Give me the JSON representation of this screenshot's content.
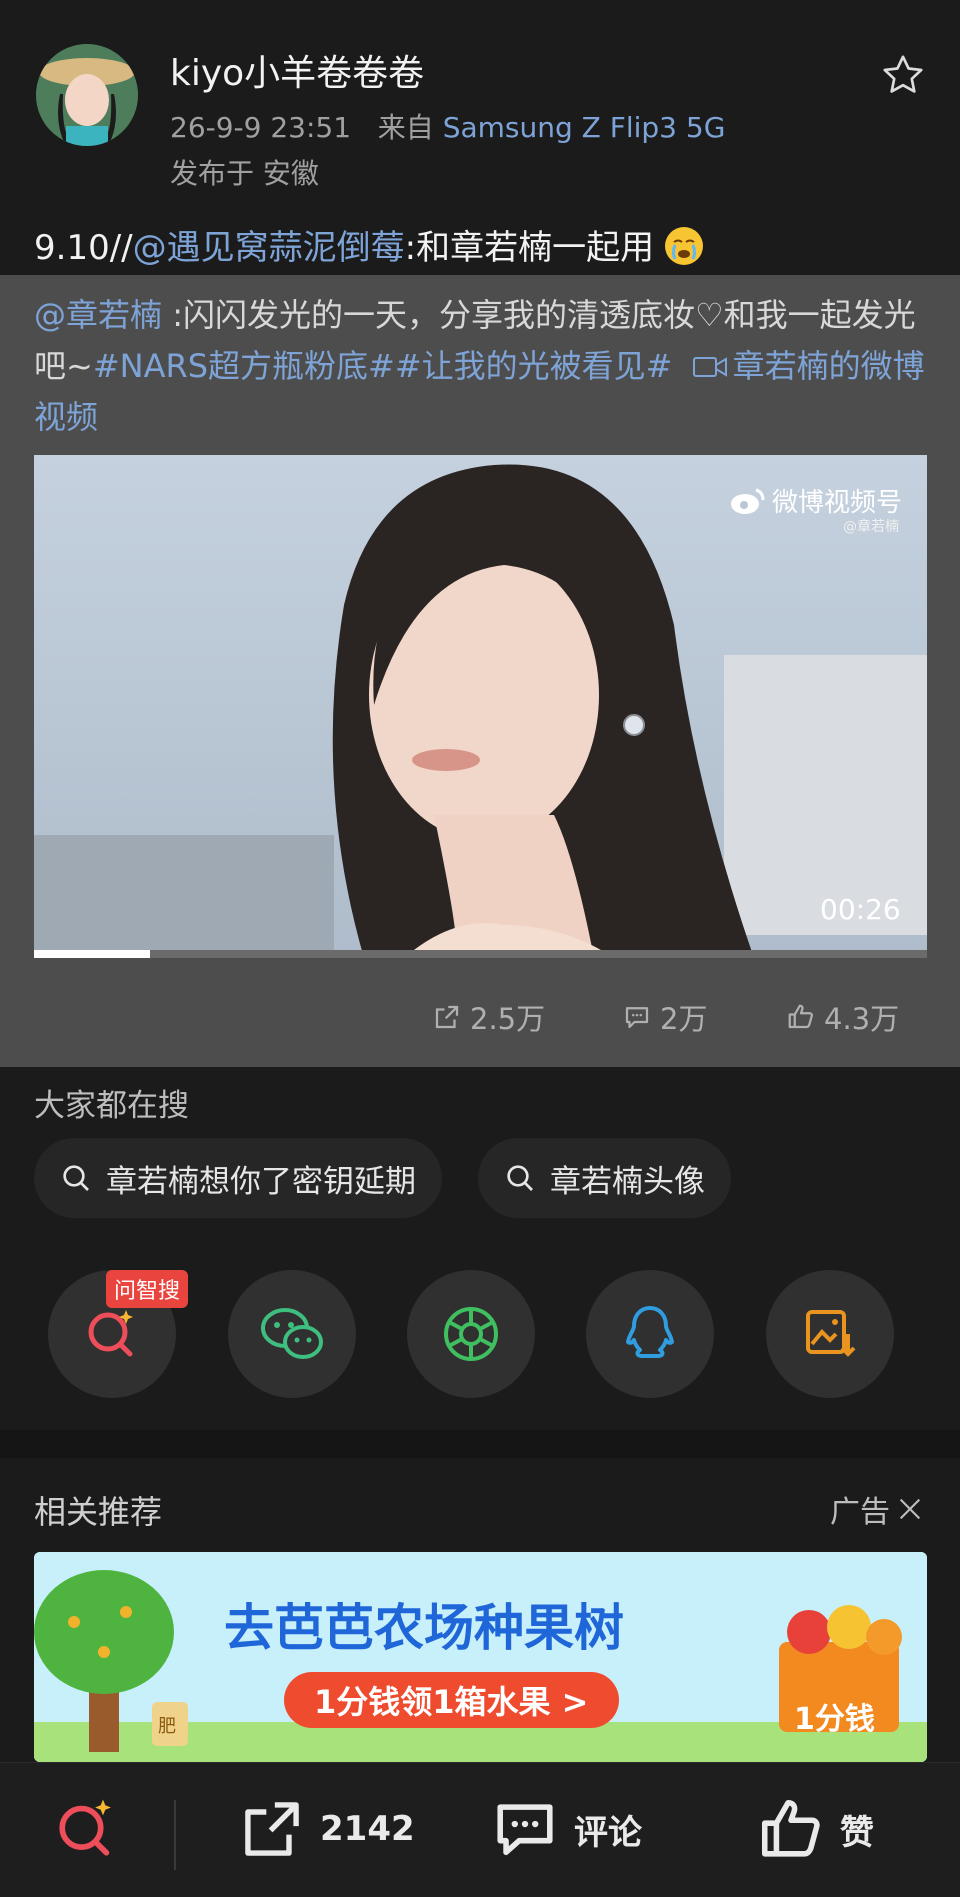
{
  "post": {
    "username": "kiyo小羊卷卷卷",
    "timestamp": "26-9-9 23:51",
    "source_prefix": "来自",
    "device": "Samsung Z Flip3 5G",
    "location": "发布于 安徽",
    "text_prefix": "9.10//",
    "mention": "@遇见窝蒜泥倒莓",
    "text_suffix": ":和章若楠一起用"
  },
  "quoted": {
    "mention": "@章若楠",
    "text": " :闪闪发光的一天，分享我的清透底妆♡和我一起发光吧~",
    "hashtag1": "#NARS超方瓶粉底#",
    "hashtag2": "#让我的光被看见#",
    "video_link": "章若楠的微博视频",
    "video": {
      "watermark": "微博视频号",
      "watermark_sub": "@章若楠",
      "duration": "00:26",
      "progress_fraction": 0.13
    },
    "stats": {
      "reposts": "2.5万",
      "comments": "2万",
      "likes": "4.3万"
    }
  },
  "search": {
    "title": "大家都在搜",
    "queries": [
      "章若楠想你了密钥延期",
      "章若楠头像"
    ]
  },
  "share": {
    "badge": "问智搜",
    "icons": [
      "ai-search-icon",
      "wechat-icon",
      "moments-icon",
      "qq-icon",
      "save-image-icon"
    ]
  },
  "recommend": {
    "title": "相关推荐",
    "ad_label": "广告",
    "ad": {
      "headline": "去芭芭农场种果树",
      "cta": "1分钱领1箱水果 >",
      "price_tag": "1分钱",
      "sack_label": "肥"
    }
  },
  "bottom_bar": {
    "repost_count": "2142",
    "comment_label": "评论",
    "like_label": "赞"
  },
  "colors": {
    "link": "#7ea3d6",
    "badge": "#e9453e",
    "background": "#1b1b1b",
    "quoted_background": "#4d4d4d"
  }
}
